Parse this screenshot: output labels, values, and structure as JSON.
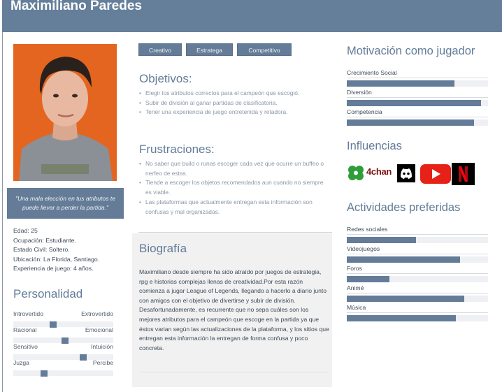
{
  "persona": {
    "name": "Maximiliano Paredes",
    "quote": "\"Una mala elección en tus atributos te puede llevar a perder la partida.\""
  },
  "info": [
    {
      "key": "Edad",
      "value": "25"
    },
    {
      "key": "Ocupación",
      "value": "Estudiante."
    },
    {
      "key": "Estado Civil",
      "value": "Soltero."
    },
    {
      "key": "Ubicación",
      "value": "La Florida, Santiago."
    },
    {
      "key": "Experiencia de juego",
      "value": "4 años."
    }
  ],
  "personality": {
    "title": "Personalidad",
    "sliders": [
      {
        "left": "Introvertido",
        "right": "Extrovertido",
        "position": 0.4
      },
      {
        "left": "Racional",
        "right": "Emocional",
        "position": 0.52
      },
      {
        "left": "Sensitivo",
        "right": "Intuición",
        "position": 0.7
      },
      {
        "left": "Juzga",
        "right": "Percibe",
        "position": 0.31
      }
    ]
  },
  "tags": [
    {
      "label": "Creativo",
      "color": "#647c97"
    },
    {
      "label": "Estratega",
      "color": "#647c97"
    },
    {
      "label": "Competitivo",
      "color": "#647c97"
    }
  ],
  "objectives": {
    "title": "Objetivos:",
    "items": [
      "Elegir los atributos correctos para el campeón que escogió.",
      "Subir de división al ganar partidas de clasificatoria.",
      "Tener una experiencia de juego entretenida y retadora."
    ]
  },
  "frustrations": {
    "title": "Frustraciones:",
    "items": [
      "No saber que build o runas escoger cada vez que ocurre un buffeo o nerfeo de estas.",
      "Tiende a escoger los objetos recomendados aun cuando no siempre es viable.",
      "Las plataformas que actualmente entregan esta información son confusas y mal organizadas."
    ]
  },
  "biography": {
    "title": "Biografía",
    "paragraphs": [
      "Maximiliano desde siempre ha sido  atraído por juegos de estrategia, rpg e historias complejas llenas de creatividad.Por esta razón comienza a jugar League of Legends, llegando a hacerlo a diario junto con amigos con el objetivo de divertirse y subir de división.",
      "Desafortunadamente, es recurrente que no sepa cuáles son los mejores atributos para el campeón que escoge en la partida ya que éstos varian según las actualizaciones de la plataforma, y los sitios que entregan esta información la entregan de forma confusa y poco concreta."
    ]
  },
  "motivation": {
    "title": "Motivación como jugador",
    "items": [
      {
        "label": "Crecimiento Social",
        "value": 0.76
      },
      {
        "label": "Diversión",
        "value": 0.95
      },
      {
        "label": "Competencia",
        "value": 0.9
      }
    ]
  },
  "influences": {
    "title": "Influencias",
    "items": [
      {
        "name": "4chan",
        "icon": "clover-icon"
      },
      {
        "name": "Discord",
        "icon": "discord-icon"
      },
      {
        "name": "YouTube",
        "icon": "youtube-icon"
      },
      {
        "name": "Netflix",
        "icon": "netflix-icon"
      }
    ],
    "fourchan_label": "4chan"
  },
  "activities": {
    "title": "Actividades preferidas",
    "items": [
      {
        "label": "Redes sociales",
        "value": 0.49
      },
      {
        "label": "Videojuegos",
        "value": 0.8
      },
      {
        "label": "Foros",
        "value": 0.3
      },
      {
        "label": "Animé",
        "value": 0.83
      },
      {
        "label": "Música",
        "value": 0.77
      }
    ]
  },
  "colors": {
    "accent": "#647c97",
    "header": "#657f9b",
    "photo_bg": "#e4651f",
    "youtube": "#e62117",
    "netflix": "#e50914",
    "clover": "#2f9e3a"
  }
}
